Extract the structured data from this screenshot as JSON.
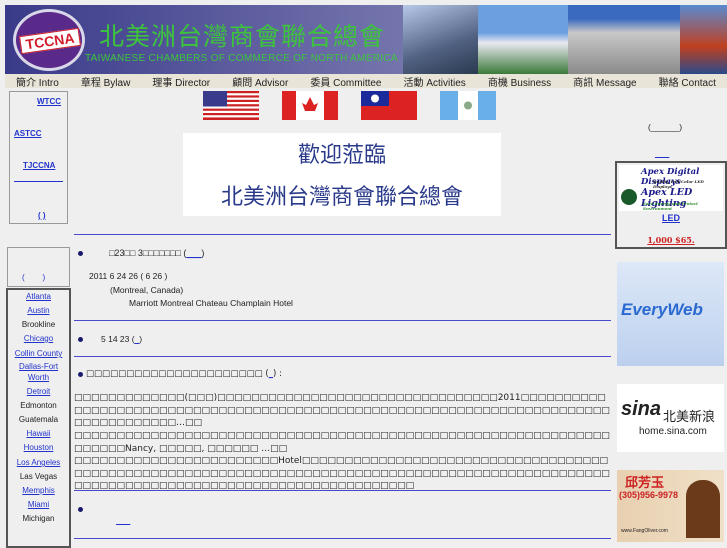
{
  "header": {
    "logo_text": "TCCNA",
    "title_cn": "北美洲台灣商會聯合總會",
    "title_en": "TAIWANESE CHAMBERS OF COMMERCE OF NORTH AMERICA"
  },
  "nav": [
    {
      "label": "簡介 Intro"
    },
    {
      "label": "章程 Bylaw"
    },
    {
      "label": "理事 Director"
    },
    {
      "label": "顧問 Advisor"
    },
    {
      "label": "委員 Committee"
    },
    {
      "label": "活動 Activities"
    },
    {
      "label": "商機 Business"
    },
    {
      "label": "商訊 Message"
    },
    {
      "label": "聯絡 Contact"
    }
  ],
  "left": {
    "links": [
      "WTCC",
      "ASTCC",
      "TJCCNA",
      "( )"
    ],
    "box2": "(        )",
    "cities": [
      {
        "name": "Atlanta",
        "link": true
      },
      {
        "name": "Austin",
        "link": true
      },
      {
        "name": "Brookline",
        "link": false
      },
      {
        "name": "Chicago",
        "link": true
      },
      {
        "name": "Collin County",
        "link": true
      },
      {
        "name": "Dallas-Fort Worth",
        "link": true
      },
      {
        "name": "Detroit",
        "link": true
      },
      {
        "name": "Edmonton",
        "link": false
      },
      {
        "name": "Guatemala",
        "link": false
      },
      {
        "name": "Hawaii",
        "link": true
      },
      {
        "name": "Houston",
        "link": true
      },
      {
        "name": "Los Angeles",
        "link": true
      },
      {
        "name": "Las Vegas",
        "link": false
      },
      {
        "name": "Memphis",
        "link": true
      },
      {
        "name": "Miami",
        "link": true
      },
      {
        "name": "Michigan",
        "link": false
      }
    ]
  },
  "welcome": {
    "line1": "歡迎蒞臨",
    "line2": "北美洲台灣商會聯合總會"
  },
  "news": [
    {
      "title": "□23□□ 3□□□□□□□ (",
      "link": "___",
      "date": "2011  6 24  26  (    6 26  )",
      "location": "(Montreal, Canada)",
      "venue": "Marriott Montreal Chateau Champlain Hotel"
    },
    {
      "title": "5 14     23      (",
      "link": "_"
    },
    {
      "title": "□□□□□□□□□□□□□□□□□□□□□□ (",
      "link": "_",
      "p1": "□□□□□□□□□□□□□(□□□)□□□□□□□□□□□□□□□□□□□□□□□□□□□□□□□□□2011□□□□□□□□□□□□□□□□□□□□□□□□□□□□□□□□□□□□□□□□□□□□□□□□□□□□□□□□□□□□□□□□□□□□□□□□□□□□□□□□□□□□□…□□",
      "p2": "□□□□□□□□□□□□□□□□□□□□□□□□□□□□□□□□□□□□□□□□□□□□□□□□□□□□□□□□□□□□□□□□□□□□□Nancy, □□□□□, □□□□□□ …□□",
      "p3": "□□□□□□□□□□□□□□□□□□□□□□□□Hotel□□□□□□□□□□□□□□□□□□□□□□□□□□□□□□□□□□□□□□□□□□□□□□□□□□□□□□□□□□□□□□□□□□□□□□□□□□□□□□□□□□□□□□□□□□□□□□□□□□□□□□□□□□□□□□□□□□□□□□□□□□□□□□□□□□□□□□□□□□□"
    },
    {
      "title": "",
      "link": "___"
    }
  ],
  "right": {
    "link1": "(______)",
    "link2": "___",
    "apex1": "Apex Digital Displays",
    "apex1_sub": "Quality Full-Color LED Displays",
    "apex2": "Apex LED Lighting",
    "apex2_sub": "Save Energy and Protect Environment",
    "led": "LED",
    "price": "1,000  $65.",
    "everyweb": "EveryWeb",
    "sina": "sina",
    "sina_cn": "北美新浪",
    "sina_url": "home.sina.com",
    "fang_cn": "邱芳玉",
    "fang_phone": "(305)956-9978",
    "fang_url": "www.FangOliver.com"
  }
}
